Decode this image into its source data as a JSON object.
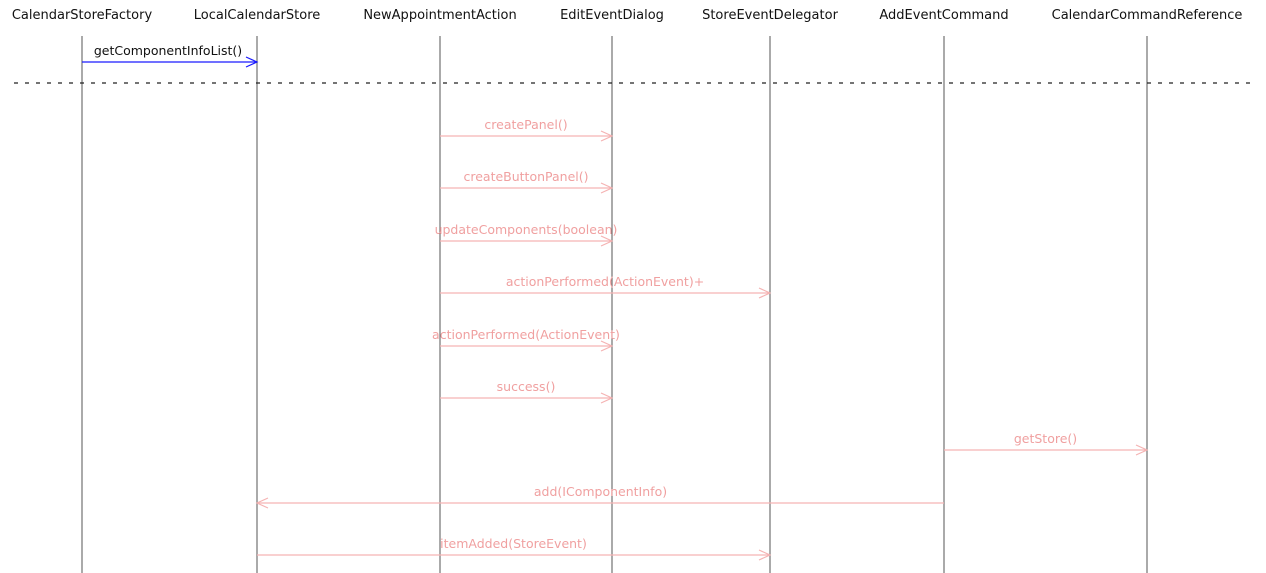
{
  "lifelines": [
    {
      "id": "csf",
      "label": "CalendarStoreFactory"
    },
    {
      "id": "lcs",
      "label": "LocalCalendarStore"
    },
    {
      "id": "naa",
      "label": "NewAppointmentAction"
    },
    {
      "id": "eed",
      "label": "EditEventDialog"
    },
    {
      "id": "sed",
      "label": "StoreEventDelegator"
    },
    {
      "id": "aec",
      "label": "AddEventCommand"
    },
    {
      "id": "ccr",
      "label": "CalendarCommandReference"
    }
  ],
  "messages": [
    {
      "label": "getComponentInfoList()",
      "from": "csf",
      "to": "lcs",
      "state": "active"
    },
    {
      "label": "createPanel()",
      "from": "naa",
      "to": "eed",
      "state": "faded"
    },
    {
      "label": "createButtonPanel()",
      "from": "naa",
      "to": "eed",
      "state": "faded"
    },
    {
      "label": "updateComponents(boolean)",
      "from": "naa",
      "to": "eed",
      "state": "faded"
    },
    {
      "label": "actionPerformed(ActionEvent)+",
      "from": "naa",
      "to": "sed",
      "state": "faded"
    },
    {
      "label": "actionPerformed(ActionEvent)",
      "from": "naa",
      "to": "eed",
      "state": "faded"
    },
    {
      "label": "success()",
      "from": "naa",
      "to": "eed",
      "state": "faded"
    },
    {
      "label": "getStore()",
      "from": "aec",
      "to": "ccr",
      "state": "faded"
    },
    {
      "label": "add(IComponentInfo)",
      "from": "aec",
      "to": "lcs",
      "state": "faded"
    },
    {
      "label": "itemAdded(StoreEvent)",
      "from": "lcs",
      "to": "sed",
      "state": "faded"
    }
  ],
  "colors": {
    "active_arrow": "#1a1aff",
    "faded_arrow": "#f5b3b3",
    "lifeline": "#555555",
    "separator": "#222222"
  }
}
